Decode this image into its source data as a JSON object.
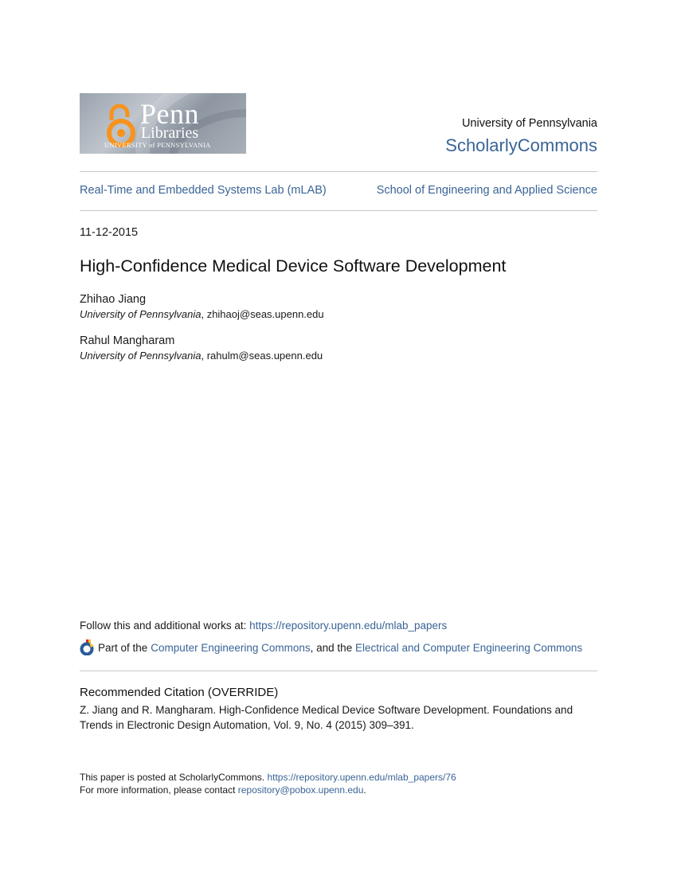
{
  "header": {
    "logo": {
      "name": "Penn",
      "sub": "Libraries",
      "university": "UNIVERSITY of PENNSYLVANIA",
      "accent_color": "#f7931d"
    },
    "institution": "University of Pennsylvania",
    "repository": "ScholarlyCommons"
  },
  "breadcrumbs": {
    "left": "Real-Time and Embedded Systems Lab (mLAB)",
    "right": "School of Engineering and Applied Science"
  },
  "document": {
    "date": "11-12-2015",
    "title": "High-Confidence Medical Device Software Development",
    "authors": [
      {
        "name": "Zhihao Jiang",
        "affiliation": "University of Pennsylvania",
        "email": ", zhihaoj@seas.upenn.edu"
      },
      {
        "name": "Rahul Mangharam",
        "affiliation": "University of Pennsylvania",
        "email": ", rahulm@seas.upenn.edu"
      }
    ]
  },
  "links": {
    "follow_label": "Follow this and additional works at: ",
    "follow_url": "https://repository.upenn.edu/mlab_papers",
    "part_of_prefix": "Part of the ",
    "commons_1": "Computer Engineering Commons",
    "part_of_middle": ", and the ",
    "commons_2": "Electrical and Computer Engineering Commons"
  },
  "citation": {
    "heading": "Recommended Citation (OVERRIDE)",
    "text": "Z. Jiang and R. Mangharam. High-Confidence Medical Device Software Development. Foundations and Trends in Electronic Design Automation, Vol. 9, No. 4 (2015) 309–391."
  },
  "footer": {
    "posted_label": "This paper is posted at ScholarlyCommons. ",
    "posted_url": "https://repository.upenn.edu/mlab_papers/76",
    "contact_label": "For more information, please contact ",
    "contact_email": "repository@pobox.upenn.edu",
    "contact_end": "."
  }
}
